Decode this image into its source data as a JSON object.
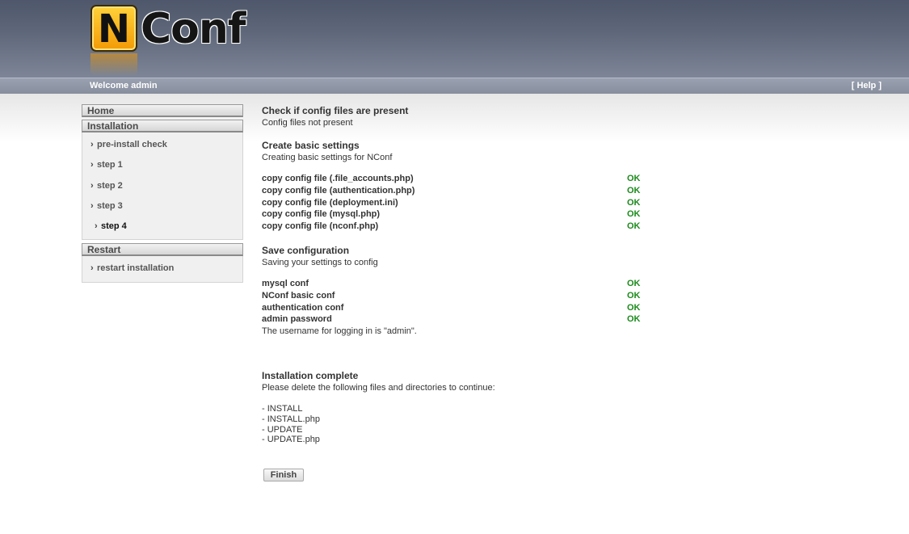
{
  "header": {
    "logo_letter": "N",
    "logo_text": "Conf"
  },
  "topbar": {
    "welcome": "Welcome admin",
    "help": "[ Help ]"
  },
  "sidebar": {
    "home": "Home",
    "installation": "Installation",
    "installation_items": [
      {
        "label": "pre-install check"
      },
      {
        "label": "step 1"
      },
      {
        "label": "step 2"
      },
      {
        "label": "step 3"
      },
      {
        "label": "step 4"
      }
    ],
    "restart": "Restart",
    "restart_items": [
      {
        "label": "restart installation"
      }
    ]
  },
  "main": {
    "check": {
      "title": "Check if config files are present",
      "desc": "Config files not present"
    },
    "basic": {
      "title": "Create basic settings",
      "desc": "Creating basic settings for NConf",
      "rows": [
        {
          "label": "copy config file (.file_accounts.php)",
          "status": "OK"
        },
        {
          "label": "copy config file (authentication.php)",
          "status": "OK"
        },
        {
          "label": "copy config file (deployment.ini)",
          "status": "OK"
        },
        {
          "label": "copy config file (mysql.php)",
          "status": "OK"
        },
        {
          "label": "copy config file (nconf.php)",
          "status": "OK"
        }
      ]
    },
    "save": {
      "title": "Save configuration",
      "desc": "Saving your settings to config",
      "rows": [
        {
          "label": "mysql conf",
          "status": "OK"
        },
        {
          "label": "NConf basic conf",
          "status": "OK"
        },
        {
          "label": "authentication conf",
          "status": "OK"
        },
        {
          "label": "admin password",
          "status": "OK"
        }
      ],
      "note": "The username for logging in is \"admin\"."
    },
    "complete": {
      "title": "Installation complete",
      "desc": "Please delete the following files and directories to continue:",
      "files": [
        "- INSTALL",
        "- INSTALL.php",
        "- UPDATE",
        "- UPDATE.php"
      ]
    },
    "finish_label": "Finish"
  }
}
